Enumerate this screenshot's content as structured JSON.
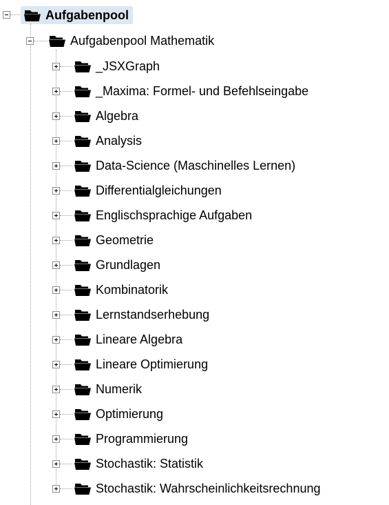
{
  "tree": {
    "root": {
      "label": "Aufgabenpool",
      "expanded": true,
      "icon": "folder-icon"
    },
    "child": {
      "label": "Aufgabenpool Mathematik",
      "expanded": true,
      "icon": "folder-icon"
    },
    "items": [
      {
        "label": "_JSXGraph"
      },
      {
        "label": "_Maxima: Formel- und Befehlseingabe"
      },
      {
        "label": "Algebra"
      },
      {
        "label": "Analysis"
      },
      {
        "label": "Data-Science (Maschinelles Lernen)"
      },
      {
        "label": "Differentialgleichungen"
      },
      {
        "label": "Englischsprachige Aufgaben"
      },
      {
        "label": "Geometrie"
      },
      {
        "label": "Grundlagen"
      },
      {
        "label": "Kombinatorik"
      },
      {
        "label": "Lernstandserhebung"
      },
      {
        "label": "Lineare Algebra"
      },
      {
        "label": "Lineare Optimierung"
      },
      {
        "label": "Numerik"
      },
      {
        "label": "Optimierung"
      },
      {
        "label": "Programmierung"
      },
      {
        "label": "Stochastik: Statistik"
      },
      {
        "label": "Stochastik: Wahrscheinlichkeitsrechnung"
      }
    ]
  },
  "colors": {
    "selection_bg": "#dde7f1",
    "connector": "#999999",
    "folder": "#000000"
  }
}
